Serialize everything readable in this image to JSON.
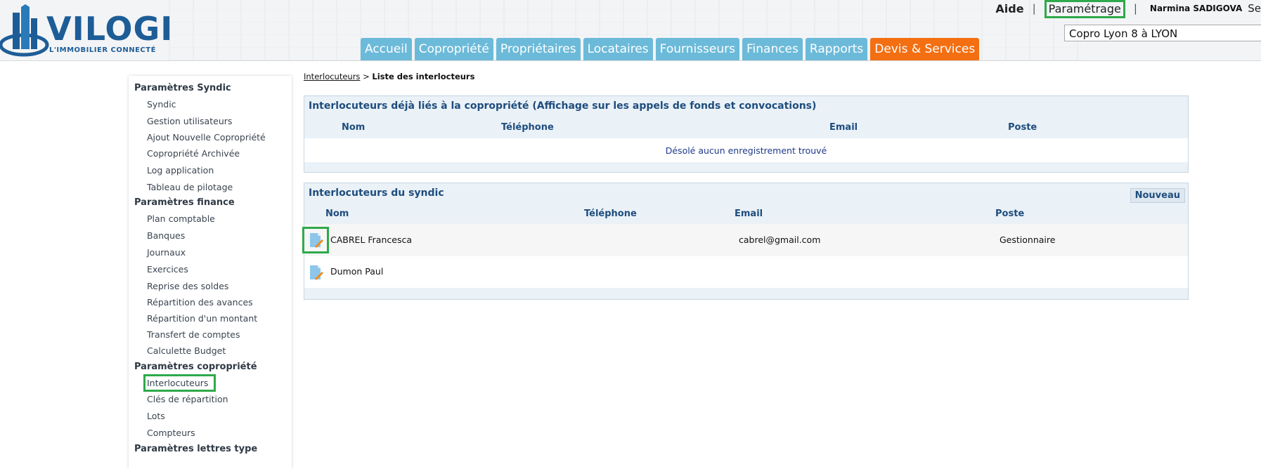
{
  "header": {
    "logo": {
      "name": "VILOGI",
      "tagline": "L'IMMOBILIER CONNECTÉ"
    },
    "top_links": {
      "help": "Aide",
      "settings": "Paramétrage",
      "separator": "|",
      "user": "Narmina SADIGOVA",
      "extra": "Se"
    },
    "copro_select": "Copro Lyon 8 à LYON",
    "nav": [
      {
        "label": "Accueil"
      },
      {
        "label": "Copropriété"
      },
      {
        "label": "Propriétaires"
      },
      {
        "label": "Locataires"
      },
      {
        "label": "Fournisseurs"
      },
      {
        "label": "Finances"
      },
      {
        "label": "Rapports"
      },
      {
        "label": "Devis & Services"
      }
    ]
  },
  "sidebar": {
    "sections": [
      {
        "title": "Paramètres Syndic",
        "items": [
          "Syndic",
          "Gestion utilisateurs",
          "Ajout Nouvelle Copropriété",
          "Copropriété Archivée",
          "Log application",
          "Tableau de pilotage"
        ]
      },
      {
        "title": "Paramètres finance",
        "items": [
          "Plan comptable",
          "Banques",
          "Journaux",
          "Exercices",
          "Reprise des soldes",
          "Répartition des avances",
          "Répartition d'un montant",
          "Transfert de comptes",
          "Calculette Budget"
        ]
      },
      {
        "title": "Paramètres copropriété",
        "items": [
          "Interlocuteurs",
          "Clés de répartition",
          "Lots",
          "Compteurs"
        ]
      },
      {
        "title": "Paramètres lettres type",
        "items": []
      }
    ]
  },
  "breadcrumb": {
    "link": "Interlocuteurs",
    "separator": ">",
    "current": "Liste des interlocteurs"
  },
  "panel_copro": {
    "title": "Interlocuteurs déjà liés à la copropriété (Affichage sur les appels de fonds et convocations)",
    "columns": [
      "Nom",
      "Téléphone",
      "Email",
      "Poste"
    ],
    "empty_message": "Désolé aucun enregistrement trouvé"
  },
  "panel_syndic": {
    "title": "Interlocuteurs du syndic",
    "new_button": "Nouveau",
    "columns": [
      "Nom",
      "Téléphone",
      "Email",
      "Poste"
    ],
    "rows": [
      {
        "nom": "CABREL Francesca",
        "telephone": "",
        "email": "cabrel@gmail.com",
        "poste": "Gestionnaire"
      },
      {
        "nom": "Dumon Paul",
        "telephone": "",
        "email": "",
        "poste": ""
      }
    ]
  },
  "colors": {
    "nav_tab": "#6cbad9",
    "nav_active": "#f36f12",
    "highlight": "#2eaa4a",
    "panel_title": "#1e4d7d"
  }
}
